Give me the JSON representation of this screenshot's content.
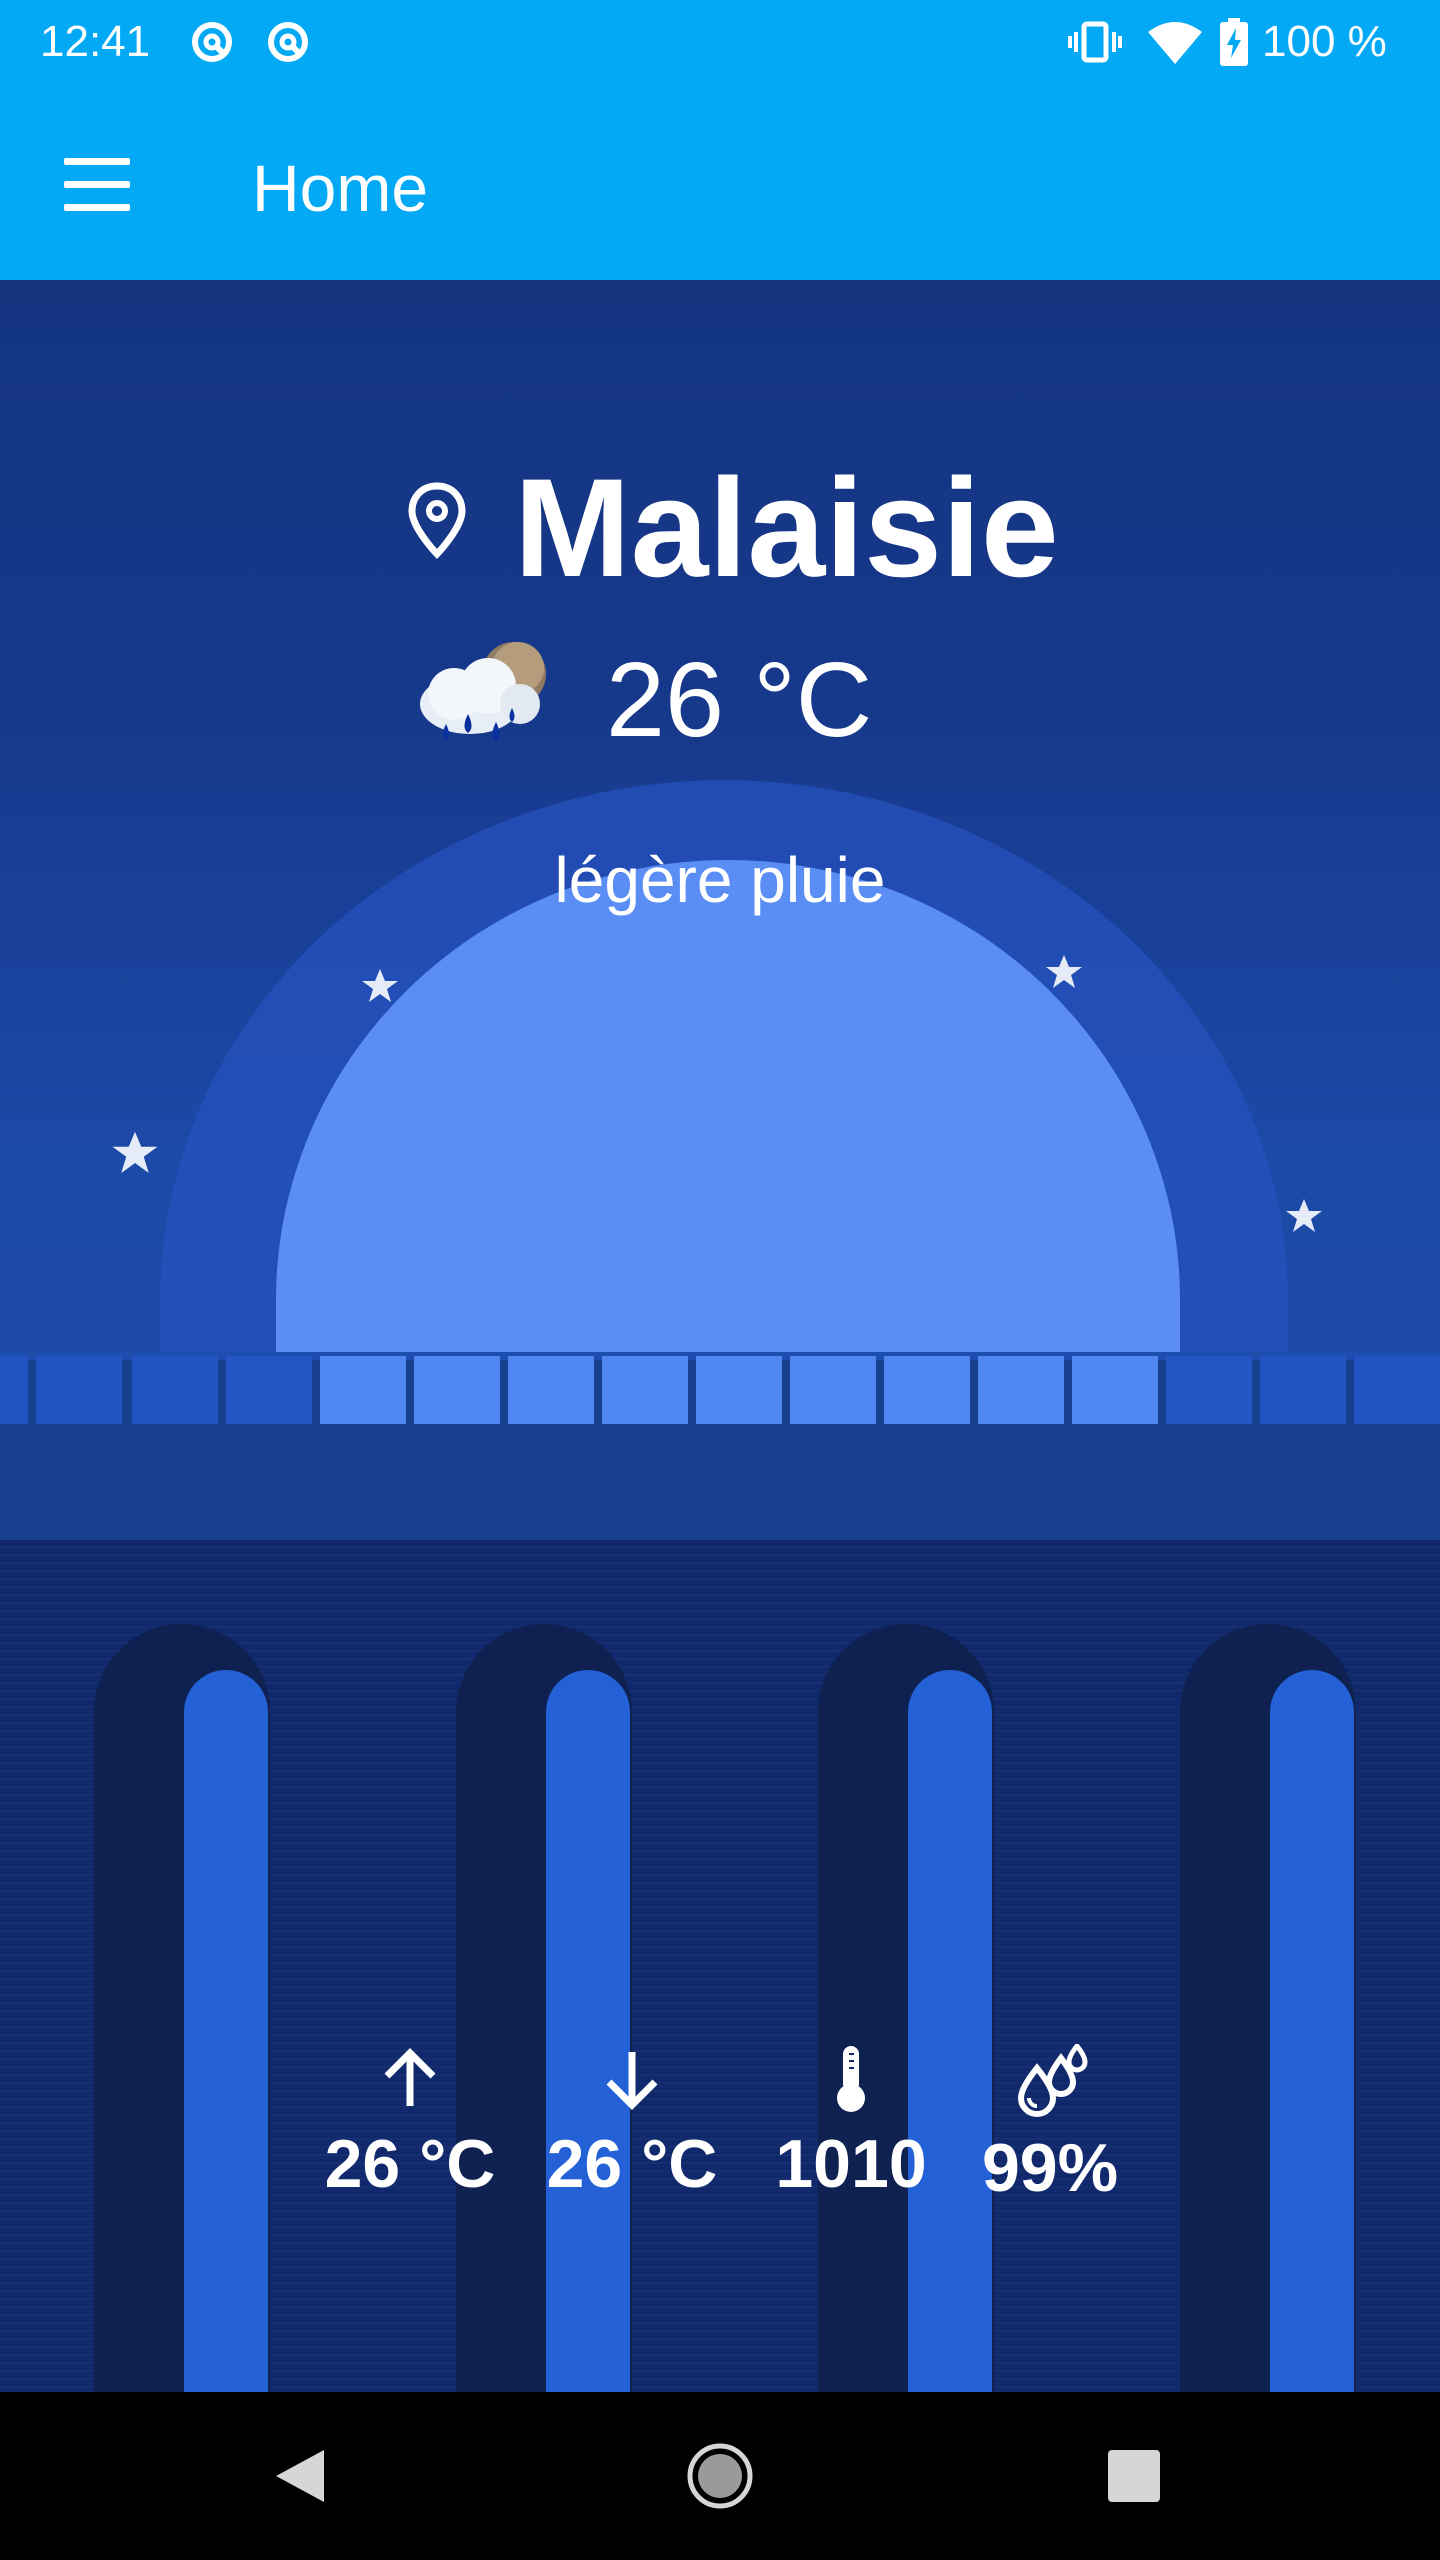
{
  "status_bar": {
    "time": "12:41",
    "left_icons": [
      "app-notification-icon",
      "app-notification-icon"
    ],
    "right_icons": [
      "vibrate-icon",
      "wifi-icon",
      "battery-charging-icon"
    ],
    "battery": "100 %"
  },
  "toolbar": {
    "menu_icon": "hamburger-menu-icon",
    "title": "Home"
  },
  "weather": {
    "location_icon": "location-pin-icon",
    "city": "Malaisie",
    "condition_icon": "rain-cloud-night-icon",
    "temperature": "26 °C",
    "description": "légère pluie"
  },
  "stats": [
    {
      "icon": "arrow-up-icon",
      "value": "26 °C"
    },
    {
      "icon": "arrow-down-icon",
      "value": "26 °C"
    },
    {
      "icon": "thermometer-icon",
      "value": "1010"
    },
    {
      "icon": "humidity-drops-icon",
      "value": "99%"
    }
  ],
  "nav_bar": {
    "buttons": [
      "back-icon",
      "home-icon",
      "recents-icon"
    ]
  },
  "colors": {
    "toolbar": "#03a9f4",
    "sky_top": "#143480",
    "moon": "#5b8ef5",
    "lower_panel": "#11296c",
    "pillar_light": "#2460d6",
    "pillar_dark": "#0e2150"
  }
}
